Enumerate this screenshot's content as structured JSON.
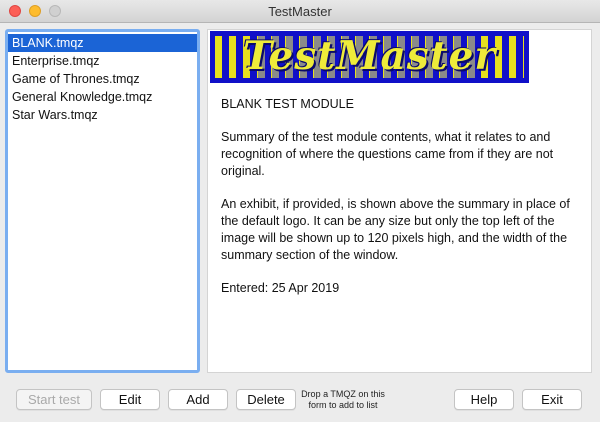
{
  "window": {
    "title": "TestMaster"
  },
  "modules": [
    {
      "label": "BLANK.tmqz",
      "selected": true
    },
    {
      "label": "Enterprise.tmqz",
      "selected": false
    },
    {
      "label": "Game of Thrones.tmqz",
      "selected": false
    },
    {
      "label": "General Knowledge.tmqz",
      "selected": false
    },
    {
      "label": "Star Wars.tmqz",
      "selected": false
    }
  ],
  "logo": {
    "text": "TestMaster",
    "colors": {
      "background": "#1010c8",
      "stripe": "#e7e01e",
      "text": "#eeeb3a"
    }
  },
  "summary": {
    "heading": "BLANK TEST MODULE",
    "paragraph1": "Summary of the test module contents, what it relates to and recognition of where the questions came from if they are not original.",
    "paragraph2": "An exhibit, if provided, is shown above the summary in place of the default logo. It can be any size but only the top left of the image will be shown up to 120 pixels high, and the width of the summary section of the window.",
    "entered": "Entered: 25 Apr 2019"
  },
  "buttons": {
    "start_test": "Start test",
    "edit": "Edit",
    "add": "Add",
    "delete": "Delete",
    "help": "Help",
    "exit": "Exit"
  },
  "drop_hint": "Drop a TMQZ on this form to add to list",
  "colors": {
    "selection": "#1b64d6",
    "list_focus_ring": "#7aaef0"
  }
}
